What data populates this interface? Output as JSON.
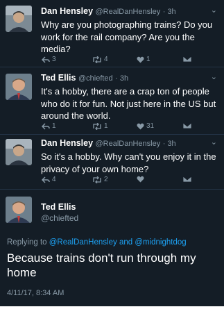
{
  "tweets": [
    {
      "name": "Dan Hensley",
      "handle": "@RealDanHensley",
      "time": "· 3h",
      "text": "Why are you photographing trains? Do you work for the rail company? Are you the media?",
      "replies": "3",
      "retweets": "4",
      "likes": "1"
    },
    {
      "name": "Ted Ellis",
      "handle": "@chiefted",
      "time": "· 3h",
      "text": "It's a hobby, there are a crap ton of people who do it for fun. Not just here in the US but around the world.",
      "replies": "1",
      "retweets": "1",
      "likes": "31"
    },
    {
      "name": "Dan Hensley",
      "handle": "@RealDanHensley",
      "time": "· 3h",
      "text": "So it's a hobby. Why can't you enjoy it in the privacy of your own home?",
      "replies": "4",
      "retweets": "2",
      "likes": ""
    }
  ],
  "main_tweet": {
    "name": "Ted Ellis",
    "handle": "@chiefted",
    "replying_prefix": "Replying to",
    "mention_1": "@RealDanHensley",
    "and": "and",
    "mention_2": "@midnightdog",
    "text": "Because trains don't run through my home",
    "timestamp": "4/11/17, 8:34 AM"
  },
  "colors": {
    "background": "#141d26",
    "secondary_text": "#8899a6",
    "link": "#1da1f2",
    "separator": "#243447"
  },
  "icons": [
    "reply-icon",
    "retweet-icon",
    "like-icon",
    "direct-message-icon",
    "chevron-down-icon"
  ]
}
